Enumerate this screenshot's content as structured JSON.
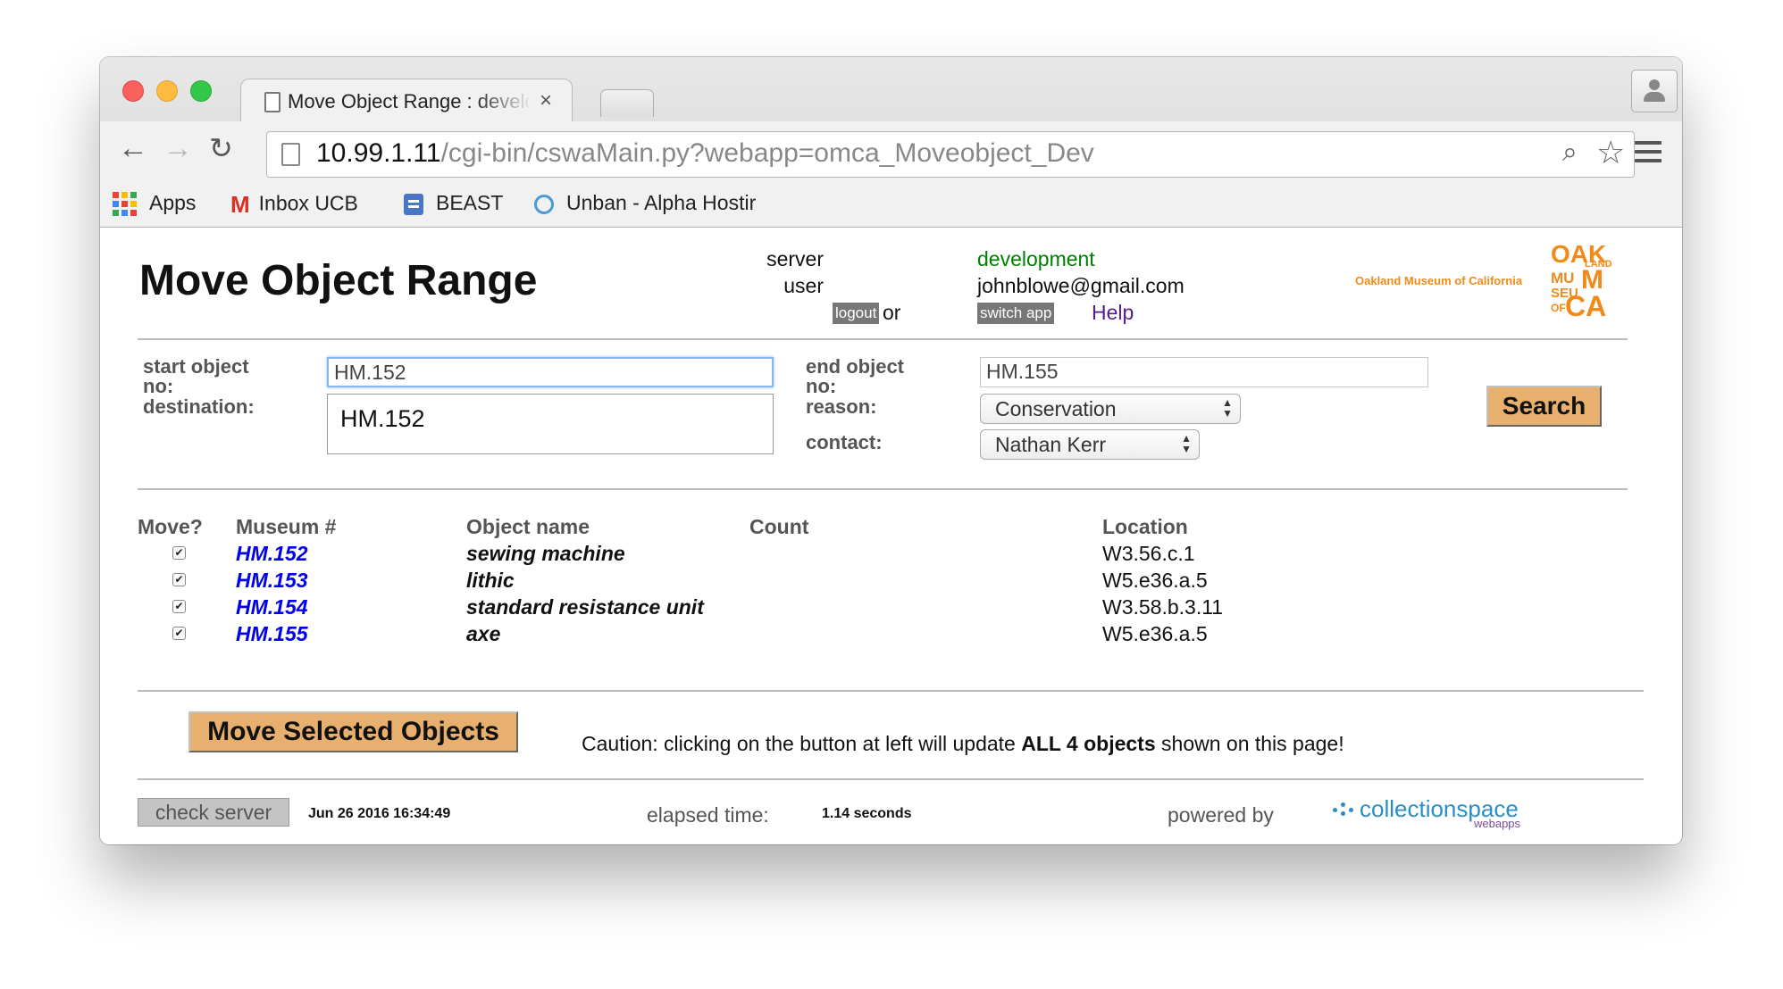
{
  "browser": {
    "tab_title": "Move Object Range : development",
    "tab_close": "×",
    "url_host": "10.99.1.11",
    "url_path": "/cgi-bin/cswaMain.py?webapp=omca_Moveobject_Dev",
    "back": "←",
    "forward": "→",
    "reload": "↻",
    "search_glyph": "🔍",
    "star_glyph": "☆",
    "bookmarks": [
      {
        "label": "Apps",
        "icon": "apps-grid-icon"
      },
      {
        "label": "Inbox UCB",
        "icon": "gmail-icon"
      },
      {
        "label": "BEAST",
        "icon": "beast-icon"
      },
      {
        "label": "Unban - Alpha Hostir",
        "icon": "unban-icon"
      }
    ],
    "gmail_glyph": "M"
  },
  "page": {
    "title": "Move Object Range",
    "server_label": "server",
    "server_value": "development",
    "user_label": "user",
    "user_value": "johnblowe@gmail.com",
    "logout": "logout",
    "or": "or",
    "switch_app": "switch app",
    "help": "Help",
    "museum_name": "Oakland Museum of California",
    "logo": {
      "oak": "OAK",
      "land": "LAND",
      "mu": "MU",
      "m": "M",
      "seu": "SEU",
      "of": "OF",
      "ca": "CA"
    }
  },
  "form": {
    "start_label_1": "start object",
    "start_label_2": "no:",
    "start_value": "HM.152",
    "end_label_1": "end object",
    "end_label_2": "no:",
    "end_value": "HM.155",
    "destination_label": "destination:",
    "autocomplete_option": "HM.152",
    "reason_label": "reason:",
    "reason_value": "Conservation",
    "contact_label": "contact:",
    "contact_value": "Nathan Kerr",
    "search_button": "Search"
  },
  "table": {
    "headers": {
      "move": "Move?",
      "museum": "Museum #",
      "object": "Object name",
      "count": "Count",
      "location": "Location"
    },
    "check_glyph": "✔",
    "rows": [
      {
        "museum": "HM.152",
        "object": "sewing machine",
        "location": "W3.56.c.1"
      },
      {
        "museum": "HM.153",
        "object": "lithic",
        "location": "W5.e36.a.5"
      },
      {
        "museum": "HM.154",
        "object": "standard resistance unit",
        "location": "W3.58.b.3.11"
      },
      {
        "museum": "HM.155",
        "object": "axe",
        "location": "W5.e36.a.5"
      }
    ]
  },
  "actions": {
    "move_button": "Move Selected Objects",
    "caution_pre": "Caution: clicking on the button at left will update ",
    "caution_bold": "ALL 4 objects",
    "caution_post": " shown on this page!"
  },
  "footer": {
    "check_server": "check server",
    "timestamp": "Jun 26 2016 16:34:49",
    "elapsed_label": "elapsed time:",
    "elapsed_value": "1.14 seconds",
    "powered_by": "powered by",
    "cs_word": "collectionspace",
    "cs_sub": "webapps"
  },
  "colors": {
    "button_tan": "#e8b06f",
    "link_blue": "#0000ee",
    "server_green": "#008000",
    "brand_orange": "#f28a1a"
  }
}
